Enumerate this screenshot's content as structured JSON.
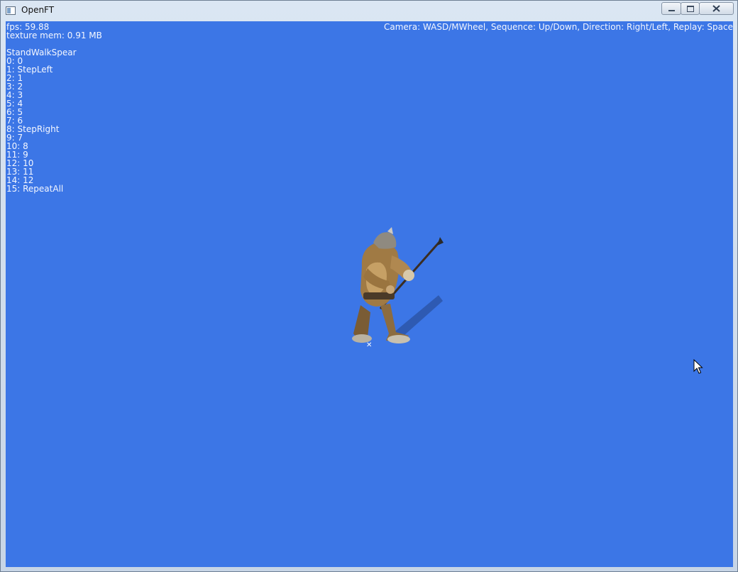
{
  "window": {
    "title": "OpenFT"
  },
  "hud": {
    "fps": "fps: 59.88",
    "texture_mem": "texture mem: 0.91 MB",
    "help": "Camera: WASD/MWheel, Sequence: Up/Down, Direction: Right/Left, Replay: Space",
    "animation_name": "StandWalkSpear",
    "sequence": [
      "0: 0",
      "1: StepLeft",
      "2: 1",
      "3: 2",
      "4: 3",
      "5: 4",
      "6: 5",
      "7: 6",
      "8: StepRight",
      "9: 7",
      "10: 8",
      "11: 9",
      "12: 10",
      "13: 11",
      "14: 12",
      "15: RepeatAll"
    ]
  },
  "scene": {
    "background_color": "#3c76e6",
    "character": "spear-warrior",
    "pivot_marker": "✕"
  },
  "icons": {
    "app": "window-icon",
    "minimize": "minimize-icon",
    "maximize": "maximize-icon",
    "close": "close-icon",
    "cursor": "mouse-pointer-icon"
  }
}
